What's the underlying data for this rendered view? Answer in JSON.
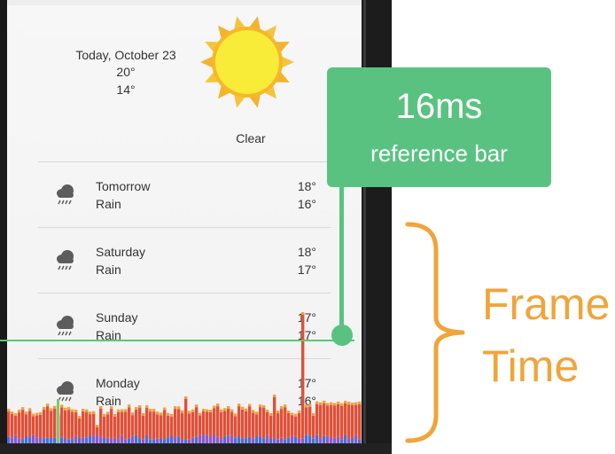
{
  "today": {
    "date": "Today, October 23",
    "high": "20°",
    "low": "14°",
    "condition": "Clear",
    "icon": "sun-icon"
  },
  "forecast": [
    {
      "day": "Tomorrow",
      "condition": "Rain",
      "high": "18°",
      "low": "16°",
      "icon": "rain-cloud-icon"
    },
    {
      "day": "Saturday",
      "condition": "Rain",
      "high": "18°",
      "low": "17°",
      "icon": "rain-cloud-icon"
    },
    {
      "day": "Sunday",
      "condition": "Rain",
      "high": "17°",
      "low": "17°",
      "icon": "rain-cloud-icon"
    },
    {
      "day": "Monday",
      "condition": "Rain",
      "high": "17°",
      "low": "16°",
      "icon": "rain-cloud-icon"
    }
  ],
  "callout": {
    "title": "16ms",
    "subtitle": "reference bar"
  },
  "annotation": {
    "line1": "Frame",
    "line2": "Time"
  },
  "colors": {
    "reference_green": "#5ac281",
    "frame_time_orange": "#f0a43a",
    "bar_red": "#e05038",
    "bar_purple": "#8a5bc8",
    "bar_blue": "#4a6fd8",
    "bar_orange": "#f0a040"
  }
}
